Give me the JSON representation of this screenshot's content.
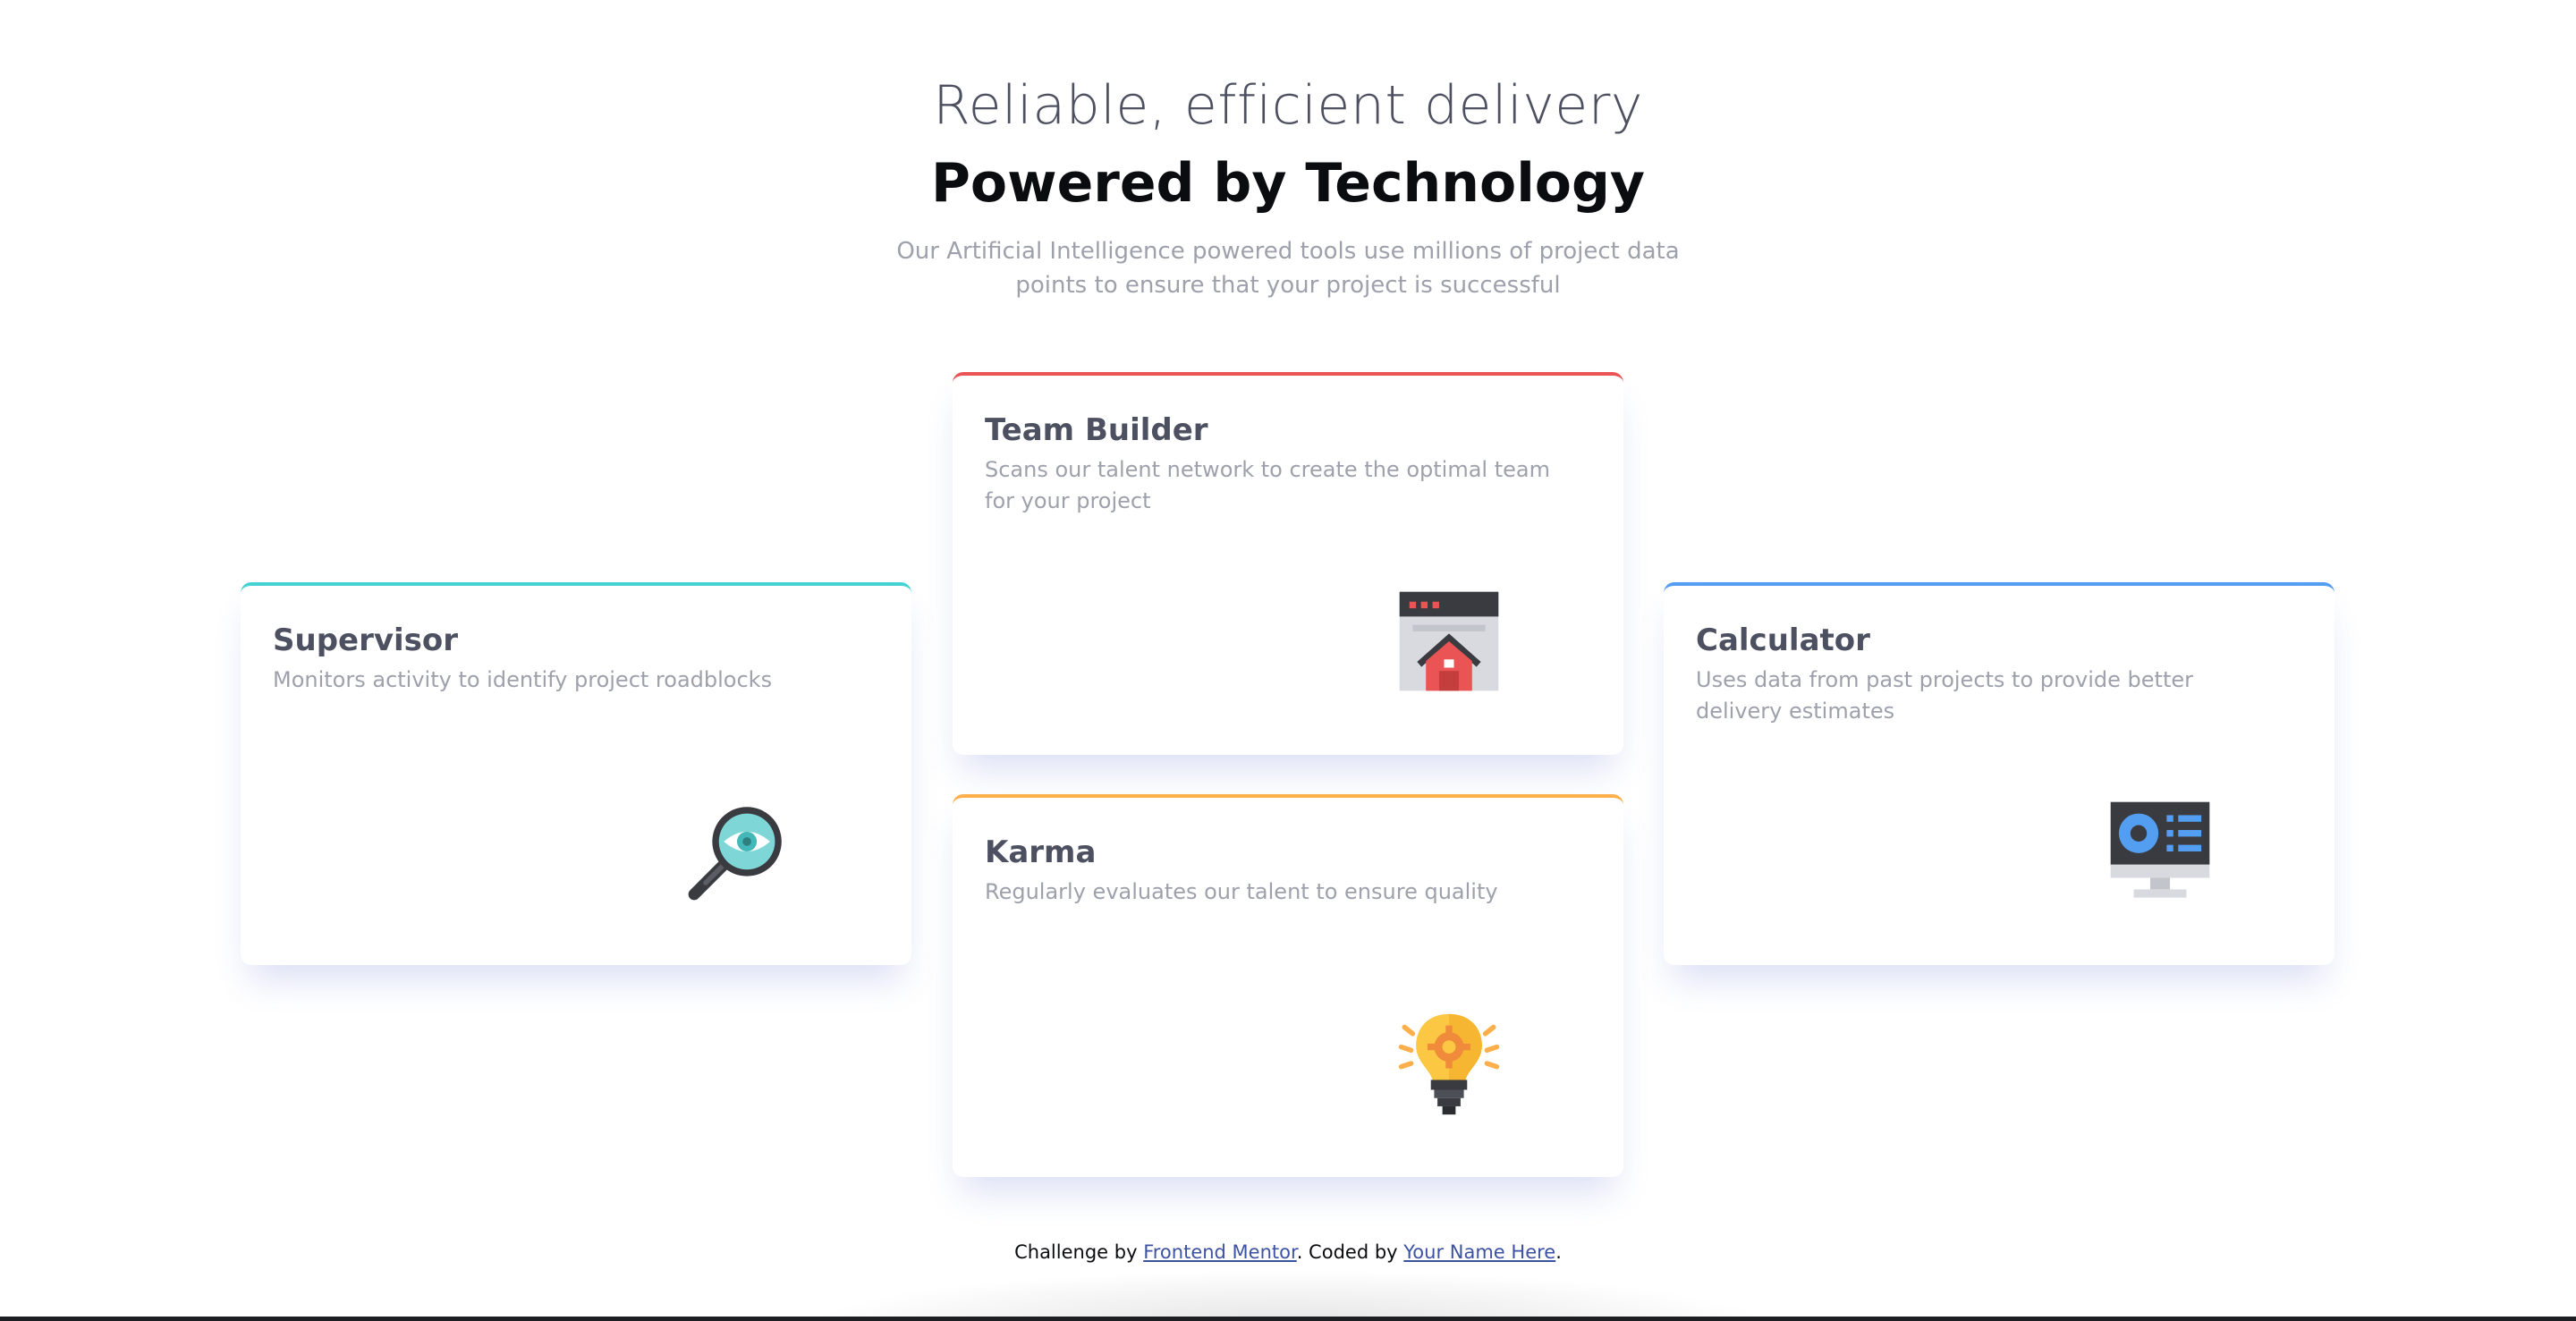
{
  "header": {
    "eyebrow": "Reliable, efficient delivery",
    "headline": "Powered by Technology",
    "intro": "Our Artificial Intelligence powered tools use millions of project data points to ensure that your project is successful"
  },
  "cards": [
    {
      "title": "Supervisor",
      "description": "Monitors activity to identify project roadblocks",
      "accent": "#44d3d2",
      "icon": "magnifier-eye-icon"
    },
    {
      "title": "Team Builder",
      "description": "Scans our talent network to create the optimal team for your project",
      "accent": "#ea5454",
      "icon": "window-house-icon"
    },
    {
      "title": "Karma",
      "description": "Regularly evaluates our talent to ensure quality",
      "accent": "#fcaf4a",
      "icon": "lightbulb-gear-icon"
    },
    {
      "title": "Calculator",
      "description": "Uses data from past projects to provide better delivery estimates",
      "accent": "#549ef2",
      "icon": "monitor-chart-icon"
    }
  ],
  "footer": {
    "prefix": "Challenge by ",
    "link1": "Frontend Mentor",
    "middle": ". Coded by ",
    "link2": "Your Name Here",
    "suffix": "."
  }
}
